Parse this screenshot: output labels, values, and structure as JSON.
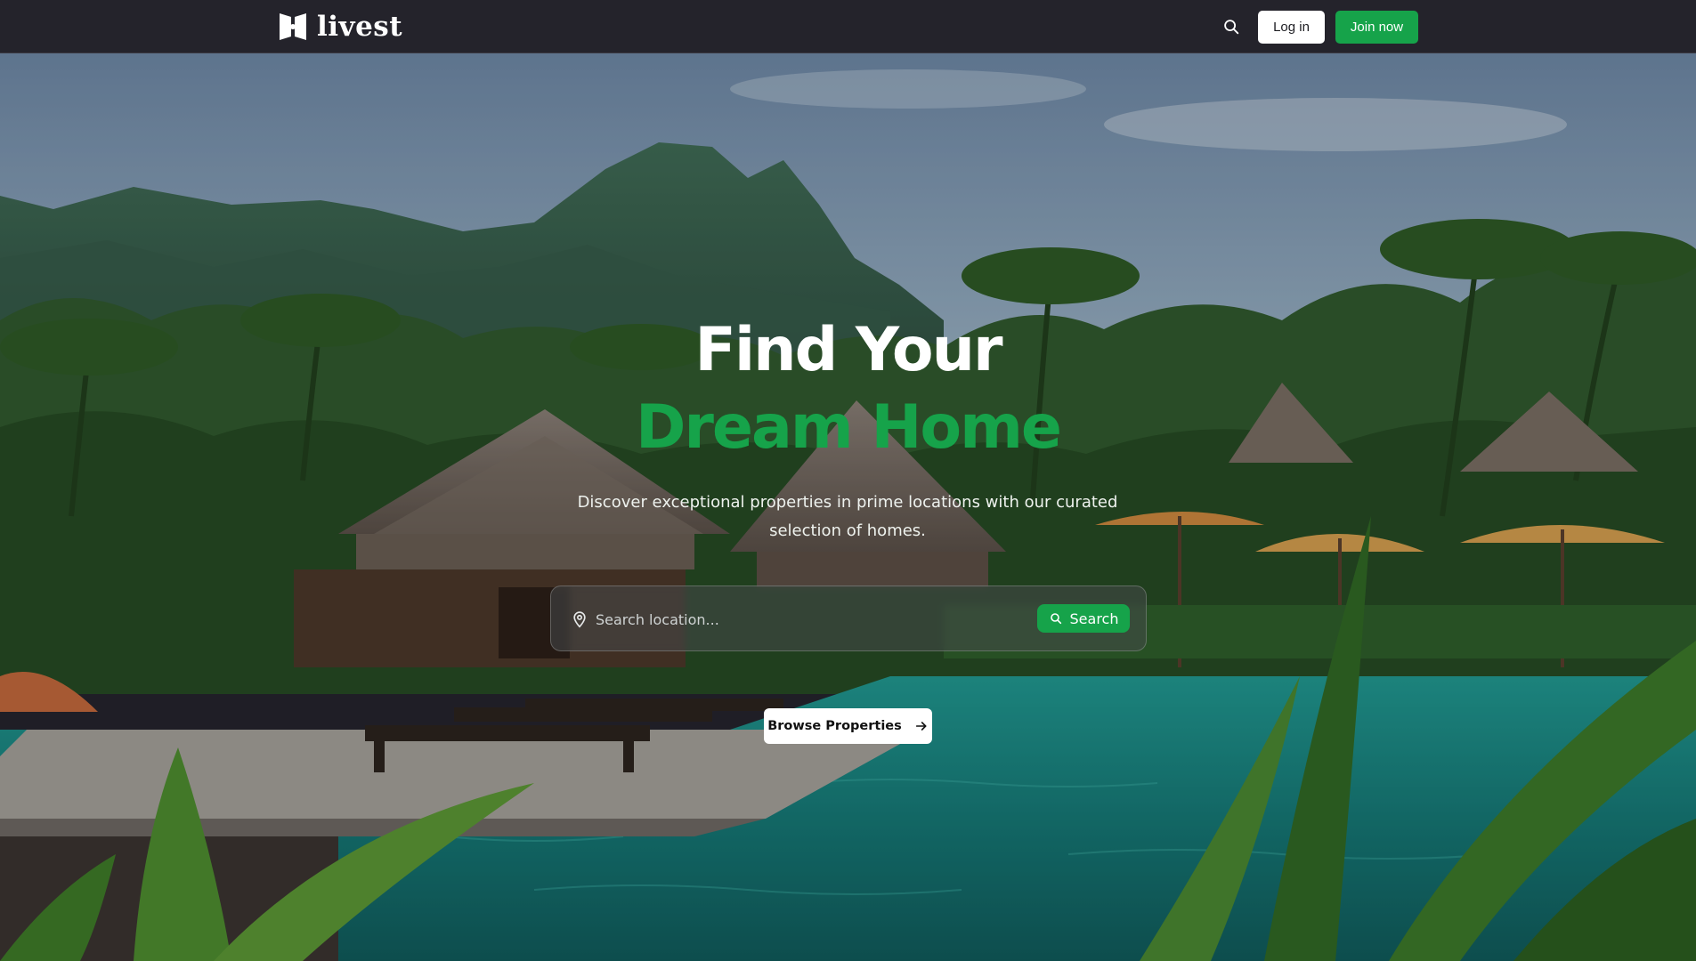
{
  "header": {
    "brand_name": "livest",
    "login_label": "Log in",
    "join_label": "Join now",
    "icons": {
      "search": "search-icon",
      "logo": "livest-logo-icon"
    }
  },
  "hero": {
    "headline_line1": "Find Your",
    "headline_line2": "Dream Home",
    "subtitle": "Discover exceptional properties in prime locations with our curated selection of homes.",
    "search_placeholder": "Search location...",
    "search_button_label": "Search",
    "browse_label": "Browse Properties",
    "icons": {
      "location": "map-pin-icon",
      "search": "search-icon",
      "arrow": "arrow-right-icon"
    }
  },
  "colors": {
    "accent_green": "#16a34a",
    "header_bg": "#24232b",
    "white": "#ffffff"
  }
}
